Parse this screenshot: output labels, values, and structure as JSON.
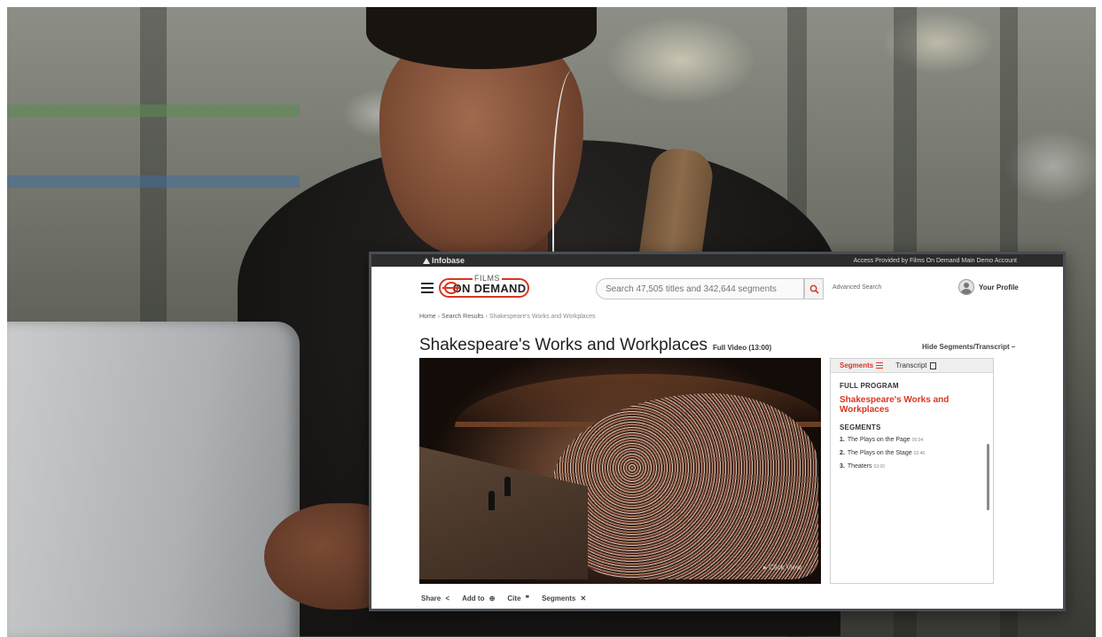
{
  "topbar": {
    "brand_bold": "Infobase",
    "access_text": "Access Provided by Films On Demand Main Demo Account"
  },
  "header": {
    "logo_films": "FILMS",
    "logo_ondemand": "ON DEMAND",
    "search_placeholder": "Search 47,505 titles and 342,644 segments",
    "advanced_search": "Advanced Search",
    "profile_label": "Your Profile"
  },
  "breadcrumb": {
    "home": "Home",
    "results": "Search Results",
    "current": "Shakespeare's Works and Workplaces",
    "sep": "›"
  },
  "title": {
    "main": "Shakespeare's Works and Workplaces",
    "duration": "Full Video (13:00)",
    "hide_toggle": "Hide Segments/Transcript –"
  },
  "video": {
    "click_view": "▸ Click View"
  },
  "panel": {
    "tab_segments": "Segments",
    "tab_transcript": "Transcript",
    "full_program_heading": "FULL PROGRAM",
    "full_program_title": "Shakespeare's Works and Workplaces",
    "segments_heading": "SEGMENTS",
    "segments": [
      {
        "num": "1.",
        "title": "The Plays on the Page",
        "time": "05:04"
      },
      {
        "num": "2.",
        "title": "The Plays on the Stage",
        "time": "02:46"
      },
      {
        "num": "3.",
        "title": "Theaters",
        "time": "03:20"
      }
    ]
  },
  "actions": {
    "share": "Share",
    "add_to": "Add to",
    "cite": "Cite",
    "segments": "Segments"
  },
  "colors": {
    "accent": "#d93622",
    "topbar": "#2c2c2c",
    "frame": "#4a4d52"
  }
}
